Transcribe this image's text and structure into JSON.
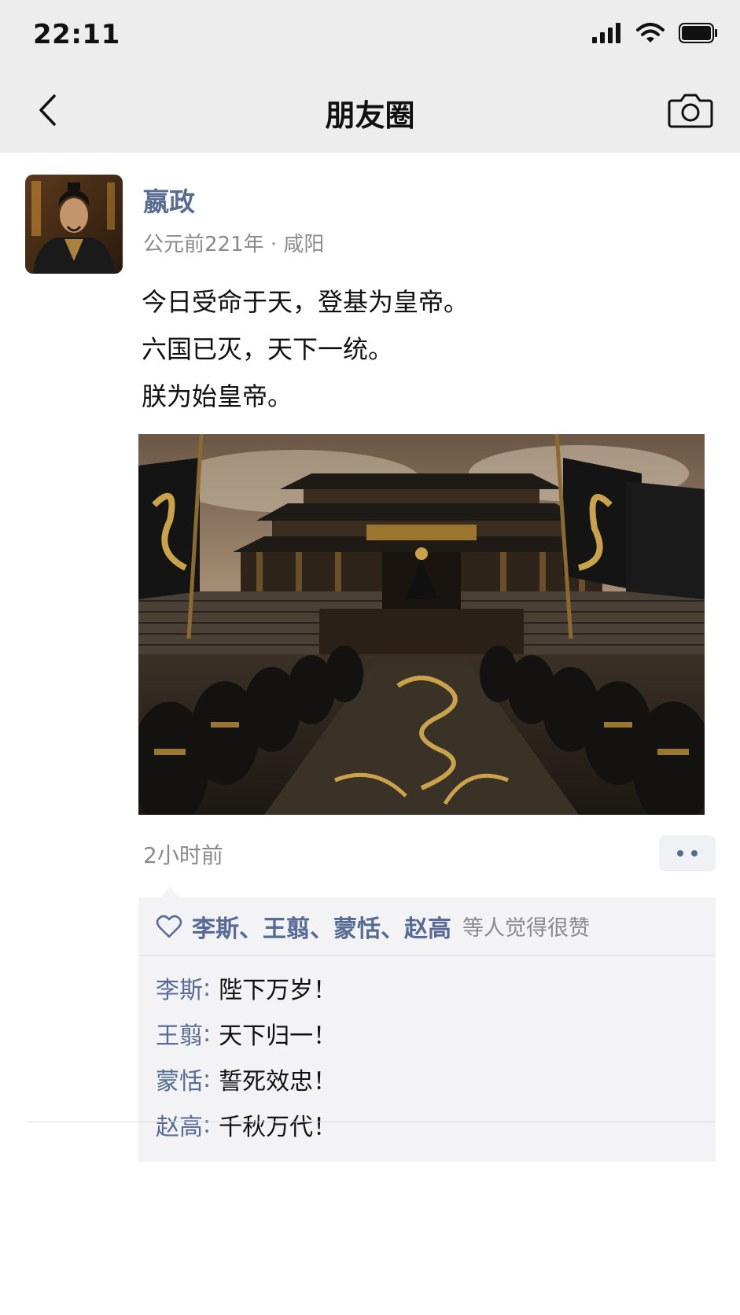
{
  "status_bar": {
    "time": "22:11",
    "icons": [
      "signal-icon",
      "wifi-icon",
      "battery-icon"
    ]
  },
  "nav": {
    "title": "朋友圈",
    "icons": [
      "chevron-left-icon",
      "camera-icon"
    ]
  },
  "post": {
    "author": "嬴政",
    "meta": "公元前221年 · 咸阳",
    "text_lines": [
      "今日受命于天，登基为皇帝。",
      "六国已灭，天下一统。",
      "朕为始皇帝。"
    ],
    "time_ago": "2小时前",
    "likes": {
      "names": "李斯、王翦、蒙恬、赵高",
      "suffix": "等人觉得很赞"
    },
    "comments": [
      {
        "author": "李斯",
        "text": "陛下万岁！"
      },
      {
        "author": "王翦",
        "text": "天下归一！"
      },
      {
        "author": "蒙恬",
        "text": "誓死效忠！"
      },
      {
        "author": "赵高",
        "text": "千秋万代！"
      }
    ]
  },
  "colors": {
    "link_blue": "#576b95",
    "nav_bg": "#ededed",
    "gold": "#c9a24a"
  }
}
